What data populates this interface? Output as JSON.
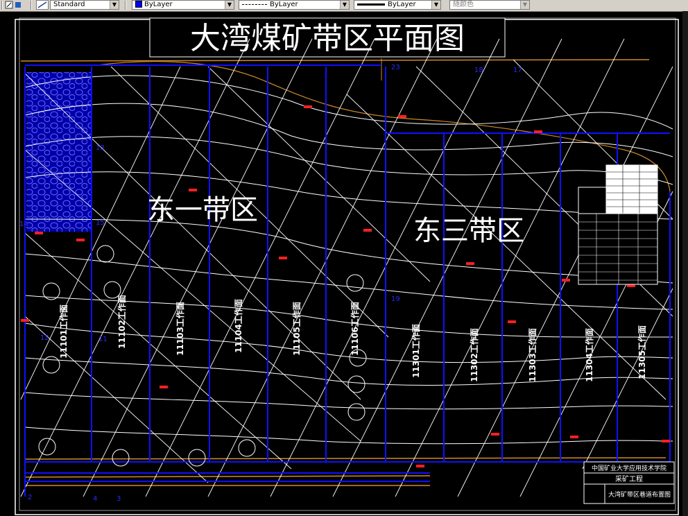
{
  "toolbar": {
    "style_value": "Standard",
    "color_value": "ByLayer",
    "linetype_value": "ByLayer",
    "lineweight_value": "ByLayer",
    "plotstyle_value": "随颜色"
  },
  "drawing": {
    "title": "大湾煤矿带区平面图",
    "regions": [
      {
        "label": "东一带区"
      },
      {
        "label": "东三带区"
      }
    ],
    "work_faces": [
      {
        "label": "11101工作面"
      },
      {
        "label": "11102工作面"
      },
      {
        "label": "11103工作面"
      },
      {
        "label": "11104工作面"
      },
      {
        "label": "11105工作面"
      },
      {
        "label": "11106工作面"
      },
      {
        "label": "11301工作面"
      },
      {
        "label": "11302工作面"
      },
      {
        "label": "11303工作面"
      },
      {
        "label": "11304工作面"
      },
      {
        "label": "11305工作面"
      }
    ],
    "point_labels": [
      "18",
      "17",
      "23",
      "19",
      "14",
      "12",
      "11",
      "13",
      "15",
      "2",
      "4",
      "3"
    ],
    "title_block": {
      "school": "中国矿业大学应用技术学院",
      "dept": "采矿工程",
      "sheet": "大湾矿带区巷道布置图"
    }
  },
  "colors": {
    "background": "#000000",
    "roadway_blue": "#1010ff",
    "contour_white": "#ffffff",
    "boundary_orange": "#d08a2a",
    "marker_red": "#ff2020"
  }
}
